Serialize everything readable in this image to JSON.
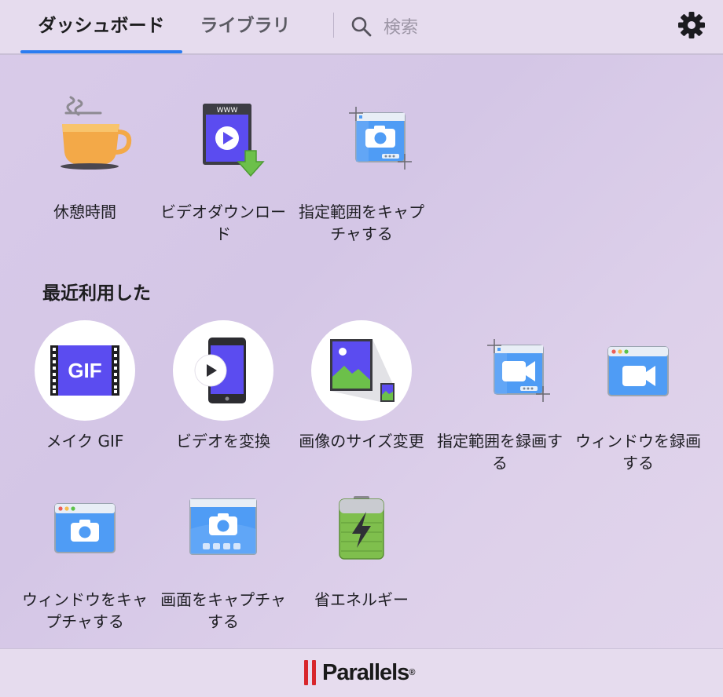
{
  "header": {
    "tabs": [
      {
        "label": "ダッシュボード",
        "active": true
      },
      {
        "label": "ライブラリ",
        "active": false
      }
    ],
    "search": {
      "placeholder": "検索",
      "value": ""
    },
    "settings_icon": "gear-icon"
  },
  "favorites": [
    {
      "label": "休憩時間",
      "icon": "coffee-cup-icon"
    },
    {
      "label": "ビデオダウンロード",
      "icon": "video-download-icon"
    },
    {
      "label": "指定範囲をキャプチャする",
      "icon": "capture-area-icon"
    }
  ],
  "recent": {
    "title": "最近利用した",
    "items": [
      {
        "label": "メイク GIF",
        "icon": "gif-icon",
        "icon_text": "GIF"
      },
      {
        "label": "ビデオを変換",
        "icon": "convert-video-icon"
      },
      {
        "label": "画像のサイズ変更",
        "icon": "resize-image-icon"
      },
      {
        "label": "指定範囲を録画する",
        "icon": "record-area-icon"
      },
      {
        "label": "ウィンドウを録画する",
        "icon": "record-window-icon"
      }
    ]
  },
  "more": [
    {
      "label": "ウィンドウをキャプチャする",
      "icon": "capture-window-icon"
    },
    {
      "label": "画面をキャプチャする",
      "icon": "capture-screen-icon"
    },
    {
      "label": "省エネルギー",
      "icon": "battery-energy-icon"
    }
  ],
  "footer": {
    "brand": "Parallels",
    "reg_mark": "®"
  },
  "colors": {
    "accent": "#2b7cf0",
    "brand_red": "#d8262b",
    "tile_blue": "#4f9cf5",
    "video_purple": "#5b4cf0"
  }
}
